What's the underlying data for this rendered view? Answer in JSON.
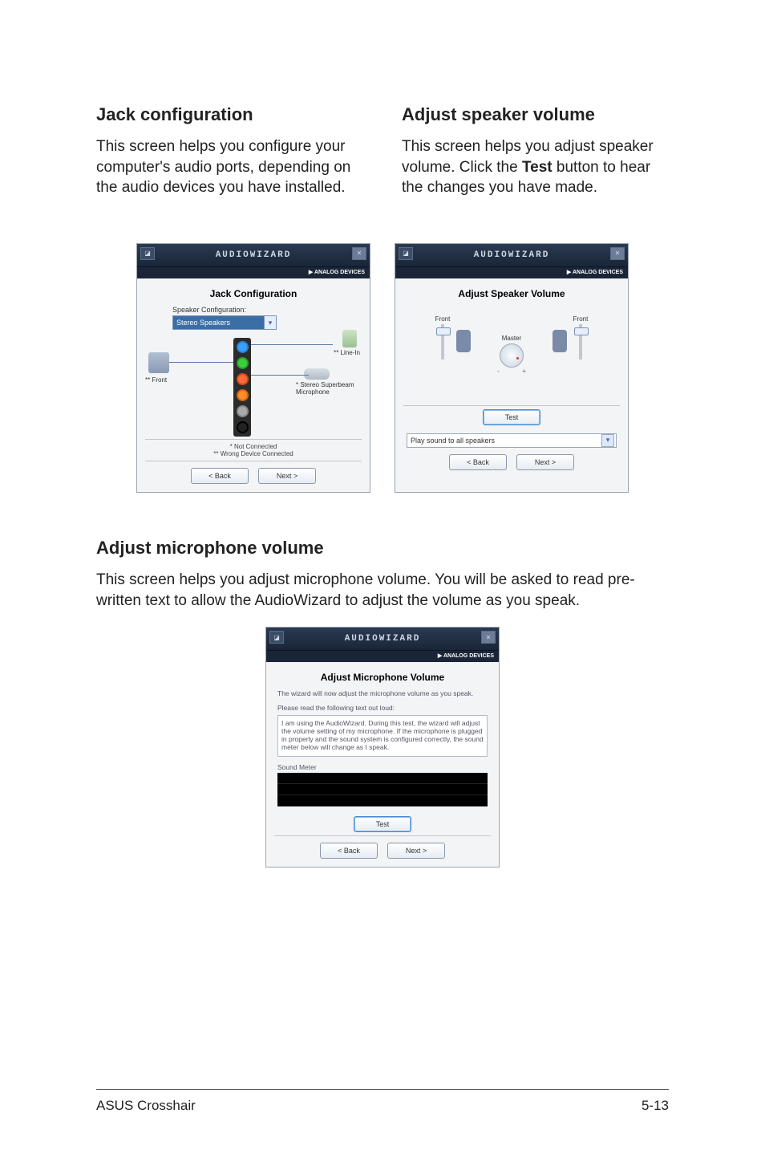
{
  "sections": {
    "jack": {
      "heading": "Jack configuration",
      "body": "This screen helps you configure your computer's audio ports, depending on the audio devices you have installed."
    },
    "volume": {
      "heading": "Adjust speaker volume",
      "body_pre": "This screen helps you adjust speaker volume. Click the ",
      "body_bold": "Test",
      "body_post": " button to hear the changes you have made."
    },
    "mic": {
      "heading": "Adjust microphone volume",
      "body": "This screen helps you adjust microphone volume. You will be asked to read pre-written text to allow the AudioWizard to adjust the volume as you speak."
    }
  },
  "dialog_common": {
    "title": "AUDIOWIZARD",
    "brand": "▶ ANALOG DEVICES",
    "back": "< Back",
    "next": "Next >"
  },
  "dlg_jack": {
    "heading": "Jack Configuration",
    "speaker_config_label": "Speaker Configuration:",
    "speaker_config_value": "Stereo Speakers",
    "front_label": "** Front",
    "linein_label": "** Line-In",
    "superbeam_label": "* Stereo Superbeam Microphone",
    "note1": "* Not Connected",
    "note2": "** Wrong Device Connected"
  },
  "dlg_vol": {
    "heading": "Adjust Speaker Volume",
    "front_l": "Front",
    "front_r": "Front",
    "master": "Master",
    "minus": "-",
    "plus": "+",
    "test": "Test",
    "play": "Play sound to all speakers"
  },
  "dlg_mic": {
    "heading": "Adjust Microphone Volume",
    "desc": "The wizard will now adjust the microphone volume as you speak.",
    "read_label": "Please read the following text out loud:",
    "read_text": "I am using the AudioWizard. During this test, the wizard will adjust the volume setting of my microphone. If the microphone is plugged in properly and the sound system is configured correctly, the sound meter below will change as I speak.",
    "meter_label": "Sound Meter",
    "test": "Test"
  },
  "footer": {
    "left": "ASUS Crosshair",
    "right": "5-13"
  }
}
